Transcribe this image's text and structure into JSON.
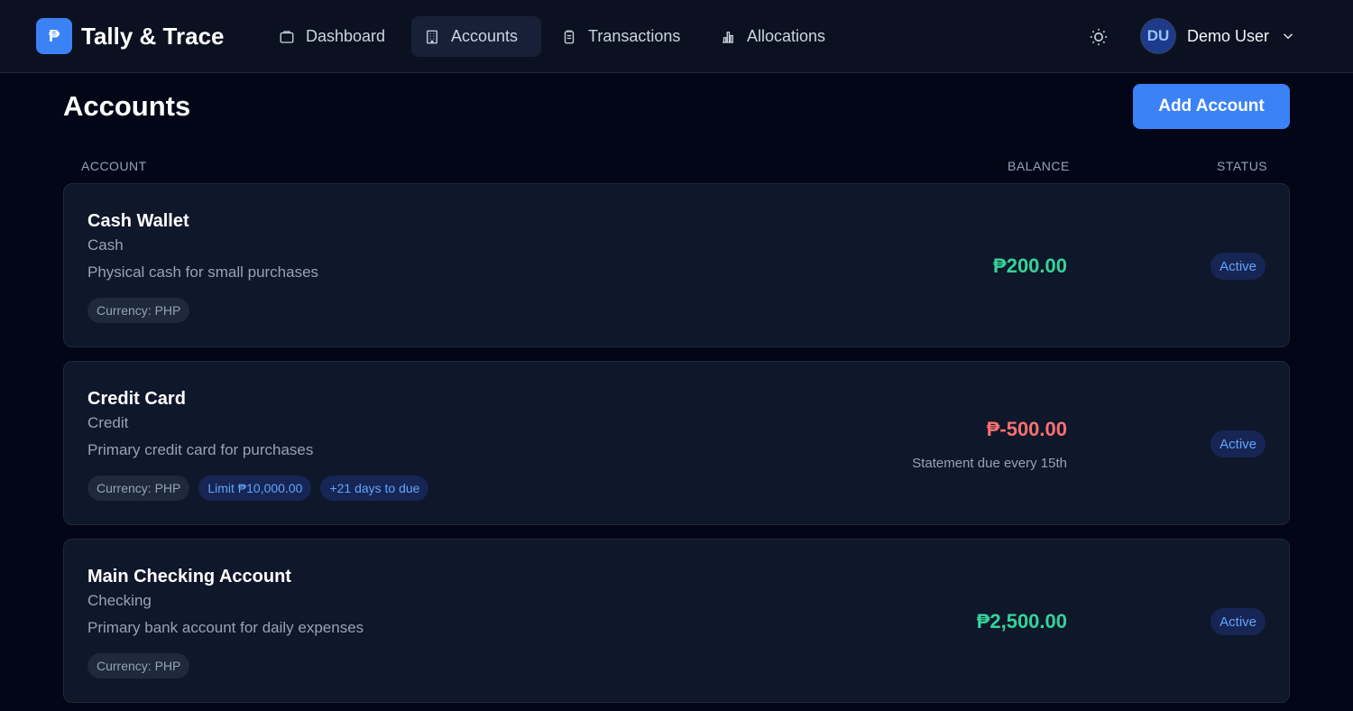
{
  "header": {
    "logo_glyph": "₱",
    "brand": "Tally & Trace",
    "nav": [
      {
        "label": "Dashboard",
        "icon": "folder-icon",
        "active": false
      },
      {
        "label": "Accounts",
        "icon": "building-icon",
        "active": true
      },
      {
        "label": "Transactions",
        "icon": "clipboard-icon",
        "active": false
      },
      {
        "label": "Allocations",
        "icon": "bar-chart-icon",
        "active": false
      }
    ],
    "theme_toggle_icon": "sun-icon",
    "user": {
      "initials": "DU",
      "name": "Demo User"
    }
  },
  "page": {
    "title": "Accounts",
    "add_button": "Add Account",
    "columns": {
      "account": "ACCOUNT",
      "balance": "BALANCE",
      "status": "STATUS"
    }
  },
  "accounts": [
    {
      "name": "Cash Wallet",
      "type": "Cash",
      "description": "Physical cash for small purchases",
      "tags": [
        {
          "text": "Currency: PHP",
          "style": "gray"
        }
      ],
      "balance": "₱200.00",
      "balance_kind": "positive",
      "balance_note": "",
      "status": "Active"
    },
    {
      "name": "Credit Card",
      "type": "Credit",
      "description": "Primary credit card for purchases",
      "tags": [
        {
          "text": "Currency: PHP",
          "style": "gray"
        },
        {
          "text": "Limit ₱10,000.00",
          "style": "blue"
        },
        {
          "text": "+21 days to due",
          "style": "blue"
        }
      ],
      "balance": "₱-500.00",
      "balance_kind": "negative",
      "balance_note": "Statement due every 15th",
      "status": "Active"
    },
    {
      "name": "Main Checking Account",
      "type": "Checking",
      "description": "Primary bank account for daily expenses",
      "tags": [
        {
          "text": "Currency: PHP",
          "style": "gray"
        }
      ],
      "balance": "₱2,500.00",
      "balance_kind": "positive",
      "balance_note": "",
      "status": "Active"
    }
  ],
  "colors": {
    "background": "#020617",
    "card": "#0f172a",
    "accent": "#3b82f6",
    "positive": "#34d399",
    "negative": "#f87171"
  }
}
